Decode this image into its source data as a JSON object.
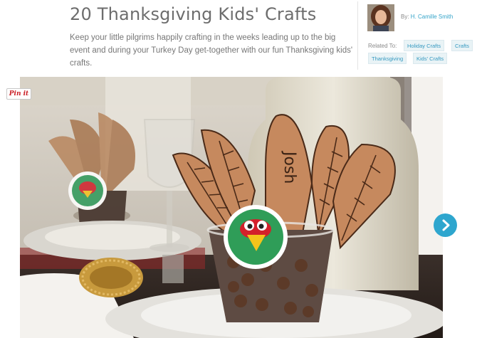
{
  "article": {
    "title": "20 Thanksgiving Kids' Crafts",
    "subtitle": "Keep your little pilgrims happily crafting in the weeks leading up to the big event and during your Turkey Day get-together with our fun Thanksgiving kids' crafts."
  },
  "author": {
    "by_label": "By:",
    "name": "H. Camille Smith"
  },
  "related": {
    "label": "Related To:",
    "tags": [
      "Holiday Crafts",
      "Crafts",
      "Thanksgiving",
      "Kids' Crafts"
    ]
  },
  "photo": {
    "place_card_name": "Josh"
  },
  "pin_button": {
    "label": "Pin it"
  },
  "slideshow": {
    "next_icon": "chevron-right-icon"
  },
  "colors": {
    "accent": "#2ea6ce",
    "link": "#35a4c9",
    "tag_bg": "#e9f3f6",
    "pin_red": "#cb2027"
  }
}
